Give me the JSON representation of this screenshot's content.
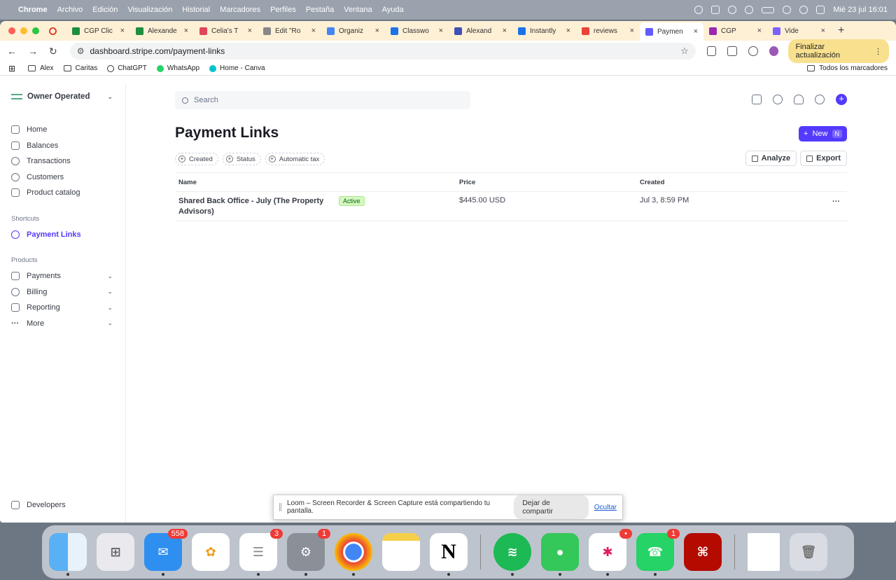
{
  "menubar": {
    "app": "Chrome",
    "items": [
      "Archivo",
      "Edición",
      "Visualización",
      "Historial",
      "Marcadores",
      "Perfiles",
      "Pestaña",
      "Ventana",
      "Ayuda"
    ],
    "clock": "Mié 23 jul 16:01"
  },
  "tabs": [
    {
      "title": "CGP Clic",
      "color": "#1e8e3e"
    },
    {
      "title": "Alexande",
      "color": "#1e8e3e"
    },
    {
      "title": "Celia's T",
      "color": "#e2445c"
    },
    {
      "title": "Edit \"Ro",
      "color": "#888888"
    },
    {
      "title": "Organiz",
      "color": "#4285f4"
    },
    {
      "title": "Classwo",
      "color": "#1a73e8"
    },
    {
      "title": "Alexand",
      "color": "#3f51b5"
    },
    {
      "title": "Instantly",
      "color": "#1a73e8"
    },
    {
      "title": "reviews",
      "color": "#ea4335"
    },
    {
      "title": "Paymen",
      "color": "#635bff"
    },
    {
      "title": "CGP",
      "color": "#9c27b0"
    },
    {
      "title": "Vide",
      "color": "#7b61ff"
    }
  ],
  "toolbar": {
    "url": "dashboard.stripe.com/payment-links",
    "update_label": "Finalizar actualización"
  },
  "bookmarks": {
    "items": [
      "Alex",
      "Caritas",
      "ChatGPT",
      "WhatsApp",
      "Home - Canva"
    ],
    "all": "Todos los marcadores"
  },
  "sidebar": {
    "account": "Owner Operated",
    "nav": [
      "Home",
      "Balances",
      "Transactions",
      "Customers",
      "Product catalog"
    ],
    "shortcuts_title": "Shortcuts",
    "shortcut": "Payment Links",
    "products_title": "Products",
    "products": [
      "Payments",
      "Billing",
      "Reporting",
      "More"
    ],
    "developers": "Developers"
  },
  "main": {
    "search_placeholder": "Search",
    "title": "Payment Links",
    "new_label": "New",
    "new_shortcut": "N",
    "filters": [
      "Created",
      "Status",
      "Automatic tax"
    ],
    "analyze": "Analyze",
    "export": "Export",
    "columns": {
      "name": "Name",
      "price": "Price",
      "created": "Created"
    },
    "rows": [
      {
        "name": "Shared Back Office - July (The Property Advisors)",
        "status": "Active",
        "price": "$445.00 USD",
        "created": "Jul 3, 8:59 PM"
      }
    ]
  },
  "loom": {
    "message": "Loom – Screen Recorder & Screen Capture está compartiendo tu pantalla.",
    "stop": "Dejar de compartir",
    "hide": "Ocultar"
  },
  "dock": {
    "mail_badge": "558",
    "reminders_badge": "3",
    "settings_badge": "1",
    "whatsapp_badge": "1"
  }
}
